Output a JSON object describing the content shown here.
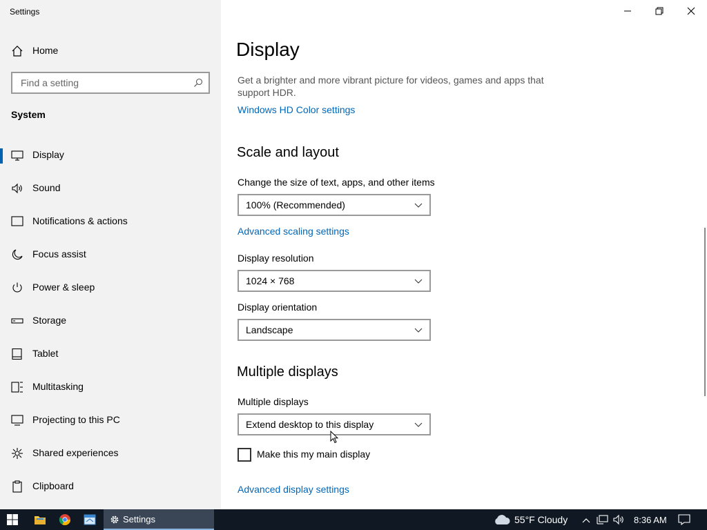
{
  "window": {
    "title": "Settings"
  },
  "sidebar": {
    "home_label": "Home",
    "search_placeholder": "Find a setting",
    "section_label": "System",
    "items": [
      {
        "label": "Display",
        "icon": "monitor-icon"
      },
      {
        "label": "Sound",
        "icon": "speaker-icon"
      },
      {
        "label": "Notifications & actions",
        "icon": "notification-icon"
      },
      {
        "label": "Focus assist",
        "icon": "moon-icon"
      },
      {
        "label": "Power & sleep",
        "icon": "power-icon"
      },
      {
        "label": "Storage",
        "icon": "storage-icon"
      },
      {
        "label": "Tablet",
        "icon": "tablet-icon"
      },
      {
        "label": "Multitasking",
        "icon": "multitasking-icon"
      },
      {
        "label": "Projecting to this PC",
        "icon": "projecting-icon"
      },
      {
        "label": "Shared experiences",
        "icon": "shared-icon"
      },
      {
        "label": "Clipboard",
        "icon": "clipboard-icon"
      }
    ],
    "active_item": "Display"
  },
  "main": {
    "title": "Display",
    "hdr_description": "Get a brighter and more vibrant picture for videos, games and apps that support HDR.",
    "hdr_link": "Windows HD Color settings",
    "scale_heading": "Scale and layout",
    "scale_label": "Change the size of text, apps, and other items",
    "scale_value": "100% (Recommended)",
    "advanced_scaling_link": "Advanced scaling settings",
    "resolution_label": "Display resolution",
    "resolution_value": "1024 × 768",
    "orientation_label": "Display orientation",
    "orientation_value": "Landscape",
    "multiple_heading": "Multiple displays",
    "multiple_label": "Multiple displays",
    "multiple_value": "Extend desktop to this display",
    "main_display_checkbox": "Make this my main display",
    "main_display_checked": false,
    "advanced_display_link": "Advanced display settings"
  },
  "taskbar": {
    "active_app": "Settings",
    "weather": "55°F  Cloudy",
    "time": "8:36 AM"
  },
  "colors": {
    "accent": "#0063b1",
    "link": "#0067b8",
    "sidebar_bg": "#f2f2f2",
    "taskbar_bg": "#101923"
  }
}
